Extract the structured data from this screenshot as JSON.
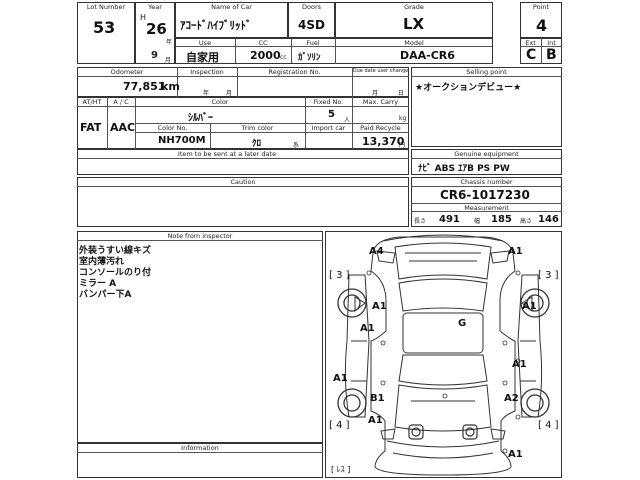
{
  "headers": {
    "lot_no": "Lot Number",
    "year": "Year",
    "name_of_car": "Name of Car",
    "doors": "Doors",
    "grade": "Grade",
    "point": "Point",
    "use": "Use",
    "cc": "CC",
    "fuel": "Fuel",
    "model": "Model",
    "ext": "Ext",
    "int": "Int",
    "odometer": "Odometer",
    "inspection": "Inspection",
    "registration_no": "Registration No.",
    "due_date": "Due date user change",
    "selling_point": "Selling point",
    "at_ht": "AT/HT",
    "ac": "A / C",
    "color": "Color",
    "fixed_no": "Fixed No.",
    "max_carry": "Max. Carry",
    "color_no": "Color No.",
    "trim_color": "Trim color",
    "import_car": "Import car",
    "paid_recycle": "Paid Recycle",
    "item_sent": "Item to be sent at a later date",
    "genuine_equipment": "Genuine equipment",
    "caution": "Caution",
    "chassis_number": "Chassis number",
    "measurement": "Measurement",
    "note_from_inspector": "Note from inspector",
    "information": "Information"
  },
  "vehicle": {
    "lot_no": "53",
    "era": "H",
    "year": "26",
    "year_unit": "年",
    "name": "ｱｺｰﾄﾞﾊｲﾌﾞﾘｯﾄﾞ",
    "doors": "4SD",
    "grade": "LX",
    "point": "4",
    "month": "9",
    "month_unit": "月",
    "use": "自家用",
    "cc": "2000",
    "cc_unit": "cc",
    "fuel": "ｶﾞｿﾘﾝ",
    "model": "DAA-CR6",
    "ext": "C",
    "int": "B",
    "odometer": "77,851",
    "odometer_unit": "km",
    "inspection_year_unit": "年",
    "inspection_month_unit": "月",
    "due_month_unit": "月",
    "due_day_unit": "日",
    "selling_point": "★オークションデビュー★",
    "at_ht": "FAT",
    "ac": "AAC",
    "color": "ｼﾙﾊﾞｰ",
    "fixed_no": "5",
    "fixed_unit": "人",
    "max_carry_unit": "kg",
    "color_no": "NH700M",
    "trim_color": "ｸﾛ",
    "trim_unit": "系",
    "paid_recycle": "13,370",
    "paid_recycle_unit": "円",
    "equipment": "ﾅﾋﾞ ABS ｴｱB PS PW",
    "chassis": "CR6-1017230",
    "length_label": "長さ",
    "length": "491",
    "width_label": "幅",
    "width": "185",
    "height_label": "高さ",
    "height": "146"
  },
  "inspector_notes": [
    "外装うすい線キズ",
    "室内薄汚れ",
    "コンソールのり付",
    "ミラー A",
    "バンパー下A"
  ],
  "damage_marks": {
    "a4_front_left": "A4",
    "a1_front_right": "A1",
    "b3_left_front": "[ 3 ]",
    "b3_right_front": "[ 3 ]",
    "a1_left_mirror": "A1",
    "a1_left_door": "A1",
    "a1_right_door_front": "A1",
    "g_roof": "G",
    "a1_right_door_rear": "A1",
    "a1_left_rear": "A1",
    "b1_left": "B1",
    "a2_right": "A2",
    "b4_left_rear": "[ 4 ]",
    "b4_right_rear": "[ 4 ]",
    "a1_rear_left": "A1",
    "a1_rear_bottom": "A1",
    "a1_trunk_right": "A1",
    "res_mark": "[ ﾚｽ ]"
  }
}
